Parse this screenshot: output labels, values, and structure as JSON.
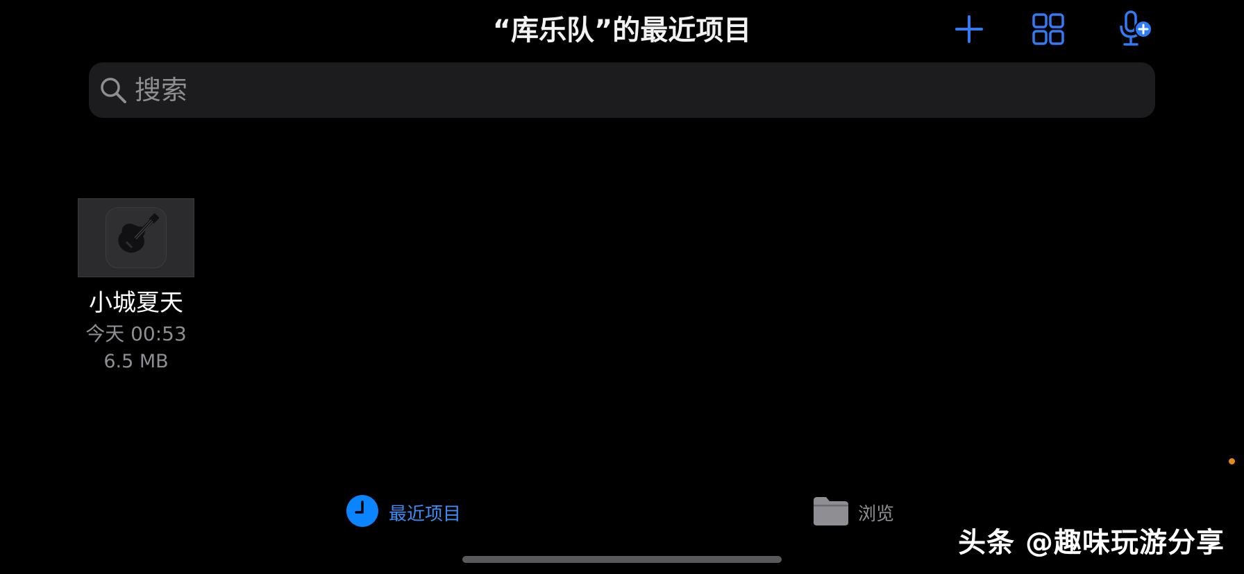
{
  "header": {
    "title": "“库乐队”的最近项目"
  },
  "toolbar": {
    "icons": [
      "plus-icon",
      "grid-icon",
      "mic-add-icon"
    ],
    "accent_color": "#2f7cf6"
  },
  "search": {
    "placeholder": "搜索"
  },
  "projects": [
    {
      "name": "小城夏天",
      "time": "今天 00:53",
      "size": "6.5 MB",
      "icon": "guitar-icon"
    }
  ],
  "tabbar": {
    "recent_label": "最近项目",
    "browse_label": "浏览",
    "active": "recent",
    "active_color": "#3a8ef6",
    "inactive_color": "#8e8e93"
  },
  "watermark": {
    "text": "头条 @趣味玩游分享"
  }
}
